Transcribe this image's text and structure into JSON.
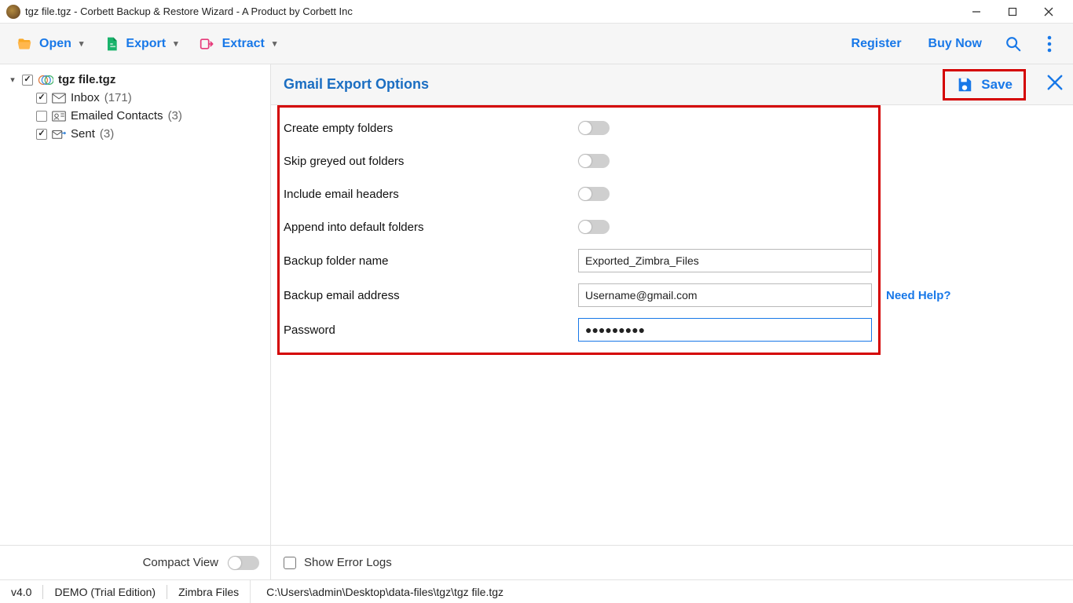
{
  "window": {
    "title": "tgz file.tgz - Corbett Backup & Restore Wizard - A Product by Corbett Inc"
  },
  "toolbar": {
    "open_label": "Open",
    "export_label": "Export",
    "extract_label": "Extract",
    "register_label": "Register",
    "buy_now_label": "Buy Now"
  },
  "tree": {
    "root": {
      "name": "tgz file.tgz",
      "checked": true,
      "expanded": true
    },
    "items": [
      {
        "name": "Inbox",
        "count": "(171)",
        "checked": true,
        "icon": "mail"
      },
      {
        "name": "Emailed Contacts",
        "count": "(3)",
        "checked": false,
        "icon": "contacts"
      },
      {
        "name": "Sent",
        "count": "(3)",
        "checked": true,
        "icon": "sent"
      }
    ]
  },
  "sidebar_footer": {
    "compact_view_label": "Compact View"
  },
  "panel": {
    "title": "Gmail Export Options",
    "save_label": "Save",
    "rows": {
      "create_empty_folders": "Create empty folders",
      "skip_greyed_out": "Skip greyed out folders",
      "include_headers": "Include email headers",
      "append_default": "Append into default folders",
      "backup_folder_name": "Backup folder name",
      "backup_email": "Backup email address",
      "password": "Password"
    },
    "values": {
      "backup_folder_name": "Exported_Zimbra_Files",
      "backup_email": "Username@gmail.com",
      "password": "●●●●●●●●●"
    },
    "need_help": "Need Help?",
    "show_error_logs": "Show Error Logs"
  },
  "status": {
    "version": "v4.0",
    "edition": "DEMO (Trial Edition)",
    "file_type": "Zimbra Files",
    "path": "C:\\Users\\admin\\Desktop\\data-files\\tgz\\tgz file.tgz"
  }
}
